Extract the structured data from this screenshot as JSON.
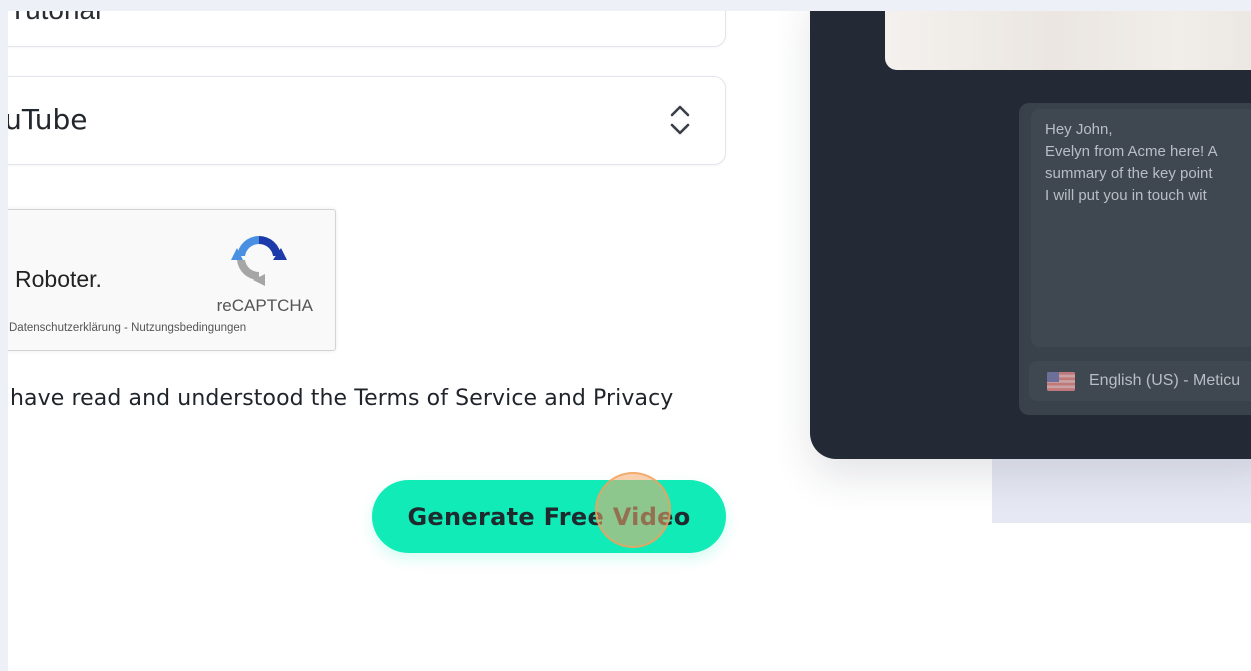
{
  "form": {
    "top_field_partial_text": "Tutorial",
    "platform_select": {
      "value": "YouTube",
      "visible_value": "ouTube"
    },
    "captcha": {
      "label": "Roboter.",
      "brand": "reCAPTCHA",
      "links": "Datenschutzerklärung - Nutzungsbedingungen"
    },
    "terms_text": "have read and understood the Terms of Service and Privacy",
    "generate_button_label": "Generate Free Video"
  },
  "preview": {
    "message_lines": [
      "Hey John,",
      "Evelyn from Acme here! A",
      "summary of the key point",
      "I will put you in touch wit"
    ],
    "language_label": "English (US) - Meticu"
  },
  "colors": {
    "accent": "#10ebb7",
    "preview_bg": "#232a35",
    "click_indicator": "#f5aa6e"
  }
}
